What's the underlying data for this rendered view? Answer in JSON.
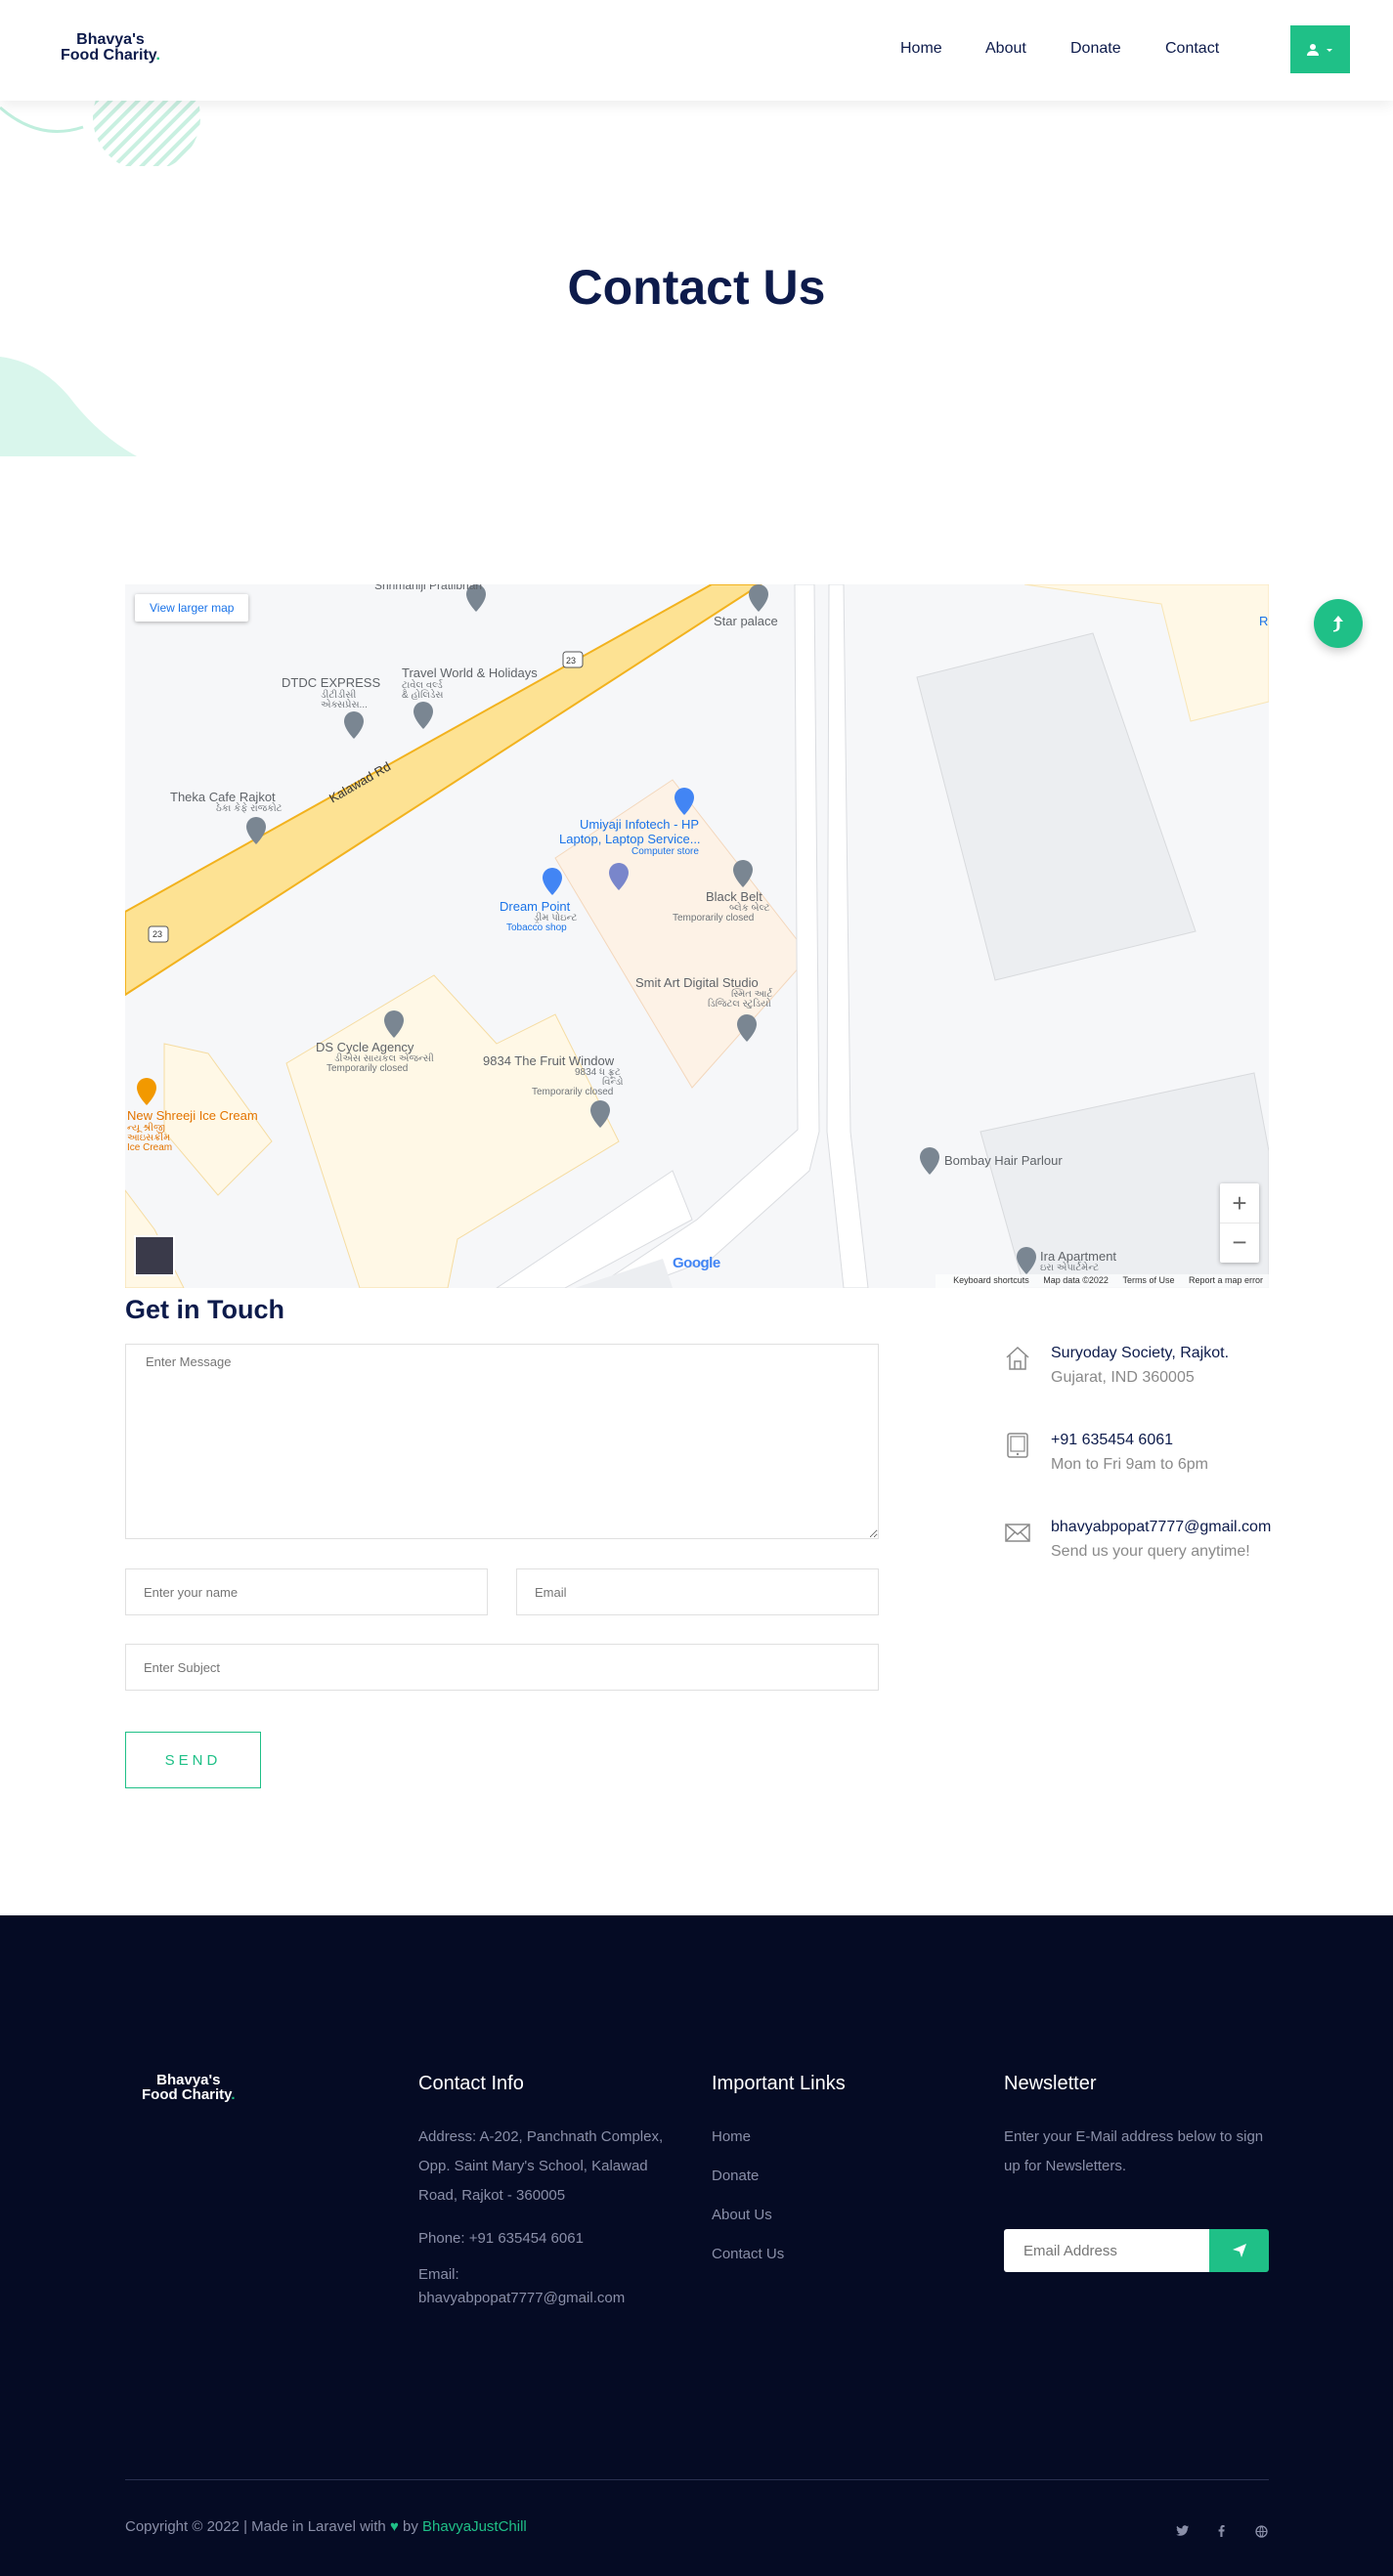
{
  "brand": {
    "line1": "Bhavya's",
    "line2": "Food Charity",
    "dot": "."
  },
  "nav": {
    "items": [
      "Home",
      "About",
      "Donate",
      "Contact"
    ]
  },
  "hero": {
    "title": "Contact Us"
  },
  "map": {
    "view_larger": "View larger map",
    "labels": {
      "star_palace": "Star palace",
      "dtdc": "DTDC EXPRESS",
      "dtdc_sub1": "ડીટીડીસી",
      "dtdc_sub2": "એક્સપ્રેસ...",
      "travel": "Travel World & Holidays",
      "travel_sub1": "ટ્રાવેલ વર્લ્ડ",
      "travel_sub2": "& હોલિડેસ",
      "kalawad": "Kalawad Rd",
      "theka": "Theka Cafe Rajkot",
      "theka_sub": "ઠેકા કેફે રાજકોટ",
      "umiyaji1": "Umiyaji Infotech - HP",
      "umiyaji2": "Laptop, Laptop Service...",
      "umiyaji_sub": "Computer store",
      "dream": "Dream Point",
      "dream_sub1": "ડ્રીમ પોઇન્ટ",
      "dream_sub2": "Tobacco shop",
      "blackbelt": "Black Belt",
      "blackbelt_sub1": "બ્લેક બેલ્ટ",
      "blackbelt_sub2": "Temporarily closed",
      "smit": "Smit Art Digital Studio",
      "smit_sub1": "સ્મિત આર્ટ",
      "smit_sub2": "ડિજિટલ સ્ટુડિયો",
      "ds": "DS Cycle Agency",
      "ds_sub1": "ડીએસ સાયકલ એજન્સી",
      "ds_sub2": "Temporarily closed",
      "fruit": "9834 The Fruit Window",
      "fruit_sub1": "9834 ધ ફ્રૂટ",
      "fruit_sub2": "વિન્ડો",
      "fruit_sub3": "Temporarily closed",
      "shreeji1": "New Shreeji Ice Cream",
      "shreeji2": "ન્યૂ શ્રીજી",
      "shreeji3": "આઇસક્રીમ",
      "shreeji4": "Ice Cream",
      "bombay": "Bombay Hair Parlour",
      "ira": "Ira Apartment",
      "ira_sub": "ઇરા એપાર્ટમેન્ટ",
      "road_num": "23",
      "top_partial": "Shrimaniji Pratiibhan",
      "r_edge": "R"
    },
    "footer": [
      "Keyboard shortcuts",
      "Map data ©2022",
      "Terms of Use",
      "Report a map error"
    ],
    "google": "Google"
  },
  "contact_form": {
    "title": "Get in Touch",
    "message_placeholder": "Enter Message",
    "name_placeholder": "Enter your name",
    "email_placeholder": "Email",
    "subject_placeholder": "Enter Subject",
    "send_label": "SEND"
  },
  "contact_info": [
    {
      "title": "Suryoday Society, Rajkot.",
      "sub": "Gujarat, IND 360005",
      "icon": "home-icon"
    },
    {
      "title": "+91 635454 6061",
      "sub": "Mon to Fri 9am to 6pm",
      "icon": "tablet-icon"
    },
    {
      "title": "bhavyabpopat7777@gmail.com",
      "sub": "Send us your query anytime!",
      "icon": "mail-icon"
    }
  ],
  "footer": {
    "contact_heading": "Contact Info",
    "address": "Address: A-202, Panchnath Complex, Opp. Saint Mary's School, Kalawad Road, Rajkot - 360005",
    "phone": "Phone: +91 635454 6061",
    "email_label": "Email:",
    "email": "bhavyabpopat7777@gmail.com",
    "links_heading": "Important Links",
    "links": [
      "Home",
      "Donate",
      "About Us",
      "Contact Us"
    ],
    "newsletter_heading": "Newsletter",
    "newsletter_text": "Enter your E-Mail address below to sign up for Newsletters.",
    "newsletter_placeholder": "Email Address",
    "copyright": "Copyright © 2022 | Made in Laravel with",
    "by": "by",
    "author": "BhavyaJustChill"
  },
  "colors": {
    "accent": "#1fc087",
    "navy": "#0d1b4b",
    "footer_bg": "#050b24"
  }
}
